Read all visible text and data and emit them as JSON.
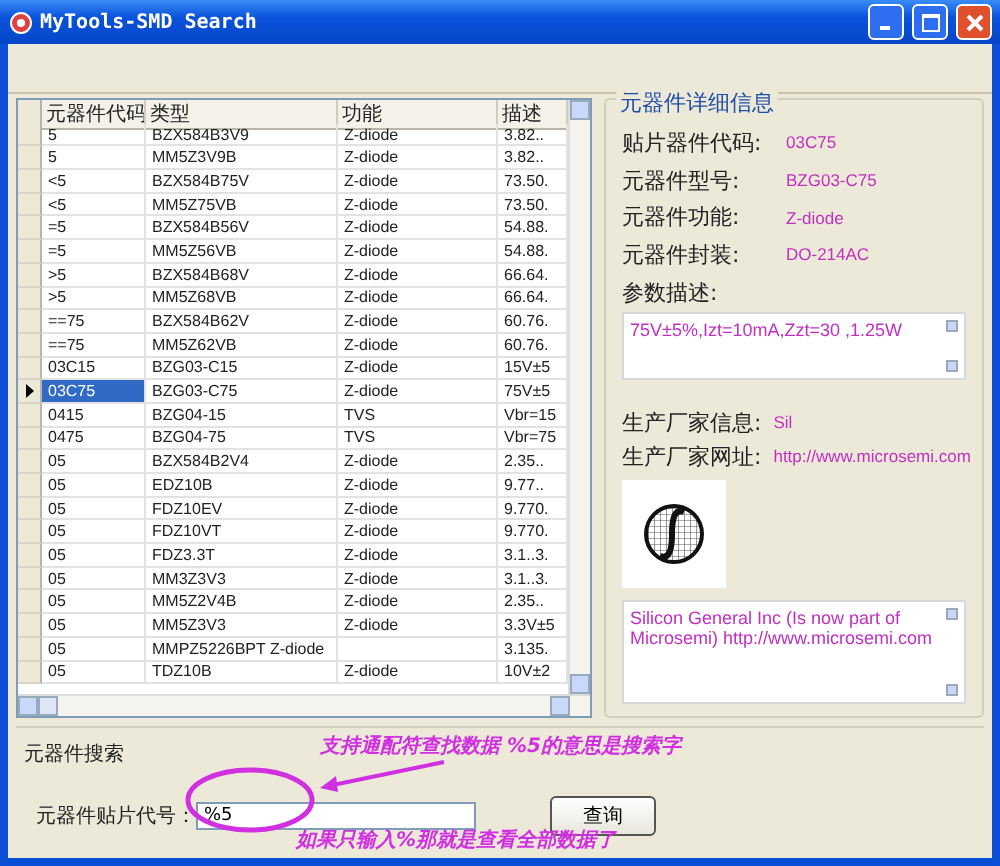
{
  "window": {
    "title": "MyTools-SMD Search"
  },
  "table": {
    "columns": [
      "元器件代码",
      "类型",
      "功能",
      "描述"
    ],
    "rows": [
      {
        "cells": [
          "5",
          "BZX584B3V9",
          "Z-diode",
          "3.82.."
        ],
        "selected": false
      },
      {
        "cells": [
          "5",
          "MM5Z3V9B",
          "Z-diode",
          "3.82.."
        ],
        "selected": false
      },
      {
        "cells": [
          "<5",
          "BZX584B75V",
          "Z-diode",
          "73.50."
        ],
        "selected": false
      },
      {
        "cells": [
          "<5",
          "MM5Z75VB",
          "Z-diode",
          "73.50."
        ],
        "selected": false
      },
      {
        "cells": [
          "=5",
          "BZX584B56V",
          "Z-diode",
          "54.88."
        ],
        "selected": false
      },
      {
        "cells": [
          "=5",
          "MM5Z56VB",
          "Z-diode",
          "54.88."
        ],
        "selected": false
      },
      {
        "cells": [
          ">5",
          "BZX584B68V",
          "Z-diode",
          "66.64."
        ],
        "selected": false
      },
      {
        "cells": [
          ">5",
          "MM5Z68VB",
          "Z-diode",
          "66.64."
        ],
        "selected": false
      },
      {
        "cells": [
          "==75",
          "BZX584B62V",
          "Z-diode",
          "60.76."
        ],
        "selected": false
      },
      {
        "cells": [
          "==75",
          "MM5Z62VB",
          "Z-diode",
          "60.76."
        ],
        "selected": false
      },
      {
        "cells": [
          "03C15",
          "BZG03-C15",
          "Z-diode",
          "15V±5"
        ],
        "selected": false
      },
      {
        "cells": [
          "03C75",
          "BZG03-C75",
          "Z-diode",
          "75V±5"
        ],
        "selected": true
      },
      {
        "cells": [
          "0415",
          "BZG04-15",
          "TVS",
          "Vbr=15"
        ],
        "selected": false
      },
      {
        "cells": [
          "0475",
          "BZG04-75",
          "TVS",
          "Vbr=75"
        ],
        "selected": false
      },
      {
        "cells": [
          "05",
          "BZX584B2V4",
          "Z-diode",
          "2.35.."
        ],
        "selected": false
      },
      {
        "cells": [
          "05",
          "EDZ10B",
          "Z-diode",
          "9.77.."
        ],
        "selected": false
      },
      {
        "cells": [
          "05",
          "FDZ10EV",
          "Z-diode",
          "9.770."
        ],
        "selected": false
      },
      {
        "cells": [
          "05",
          "FDZ10VT",
          "Z-diode",
          "9.770."
        ],
        "selected": false
      },
      {
        "cells": [
          "05",
          "FDZ3.3T",
          "Z-diode",
          "3.1..3."
        ],
        "selected": false
      },
      {
        "cells": [
          "05",
          "MM3Z3V3",
          "Z-diode",
          "3.1..3."
        ],
        "selected": false
      },
      {
        "cells": [
          "05",
          "MM5Z2V4B",
          "Z-diode",
          "2.35.."
        ],
        "selected": false
      },
      {
        "cells": [
          "05",
          "MM5Z3V3",
          "Z-diode",
          "3.3V±5"
        ],
        "selected": false
      },
      {
        "cells": [
          "05",
          "MMPZ5226BPT Z-diode",
          "",
          "3.135."
        ],
        "selected": false
      },
      {
        "cells": [
          "05",
          "TDZ10B",
          "Z-diode",
          "10V±2"
        ],
        "selected": false
      }
    ]
  },
  "details": {
    "title": "元器件详细信息",
    "fields": [
      {
        "label": "贴片器件代码:",
        "value": "03C75"
      },
      {
        "label": "元器件型号:",
        "value": "BZG03-C75"
      },
      {
        "label": "元器件功能:",
        "value": "Z-diode"
      },
      {
        "label": "元器件封装:",
        "value": "DO-214AC"
      }
    ],
    "param_label": "参数描述:",
    "param_text": "75V±5%,Izt=10mA,Zzt=30 ,1.25W",
    "maker_fields": [
      {
        "label": "生产厂家信息:",
        "value": "Sil"
      },
      {
        "label": "生产厂家网址:",
        "value": "http://www.microsemi.com"
      }
    ],
    "maker_notes": "Silicon General Inc (Is now part of Microsemi) http://www.microsemi.com"
  },
  "search": {
    "title": "元器件搜索",
    "label": "元器件贴片代号：",
    "value": "%5",
    "button": "查询"
  },
  "annotations": [
    "支持通配符查找数据 %5的意思是搜索字",
    "如果只输入%那就是查看全部数据了"
  ]
}
